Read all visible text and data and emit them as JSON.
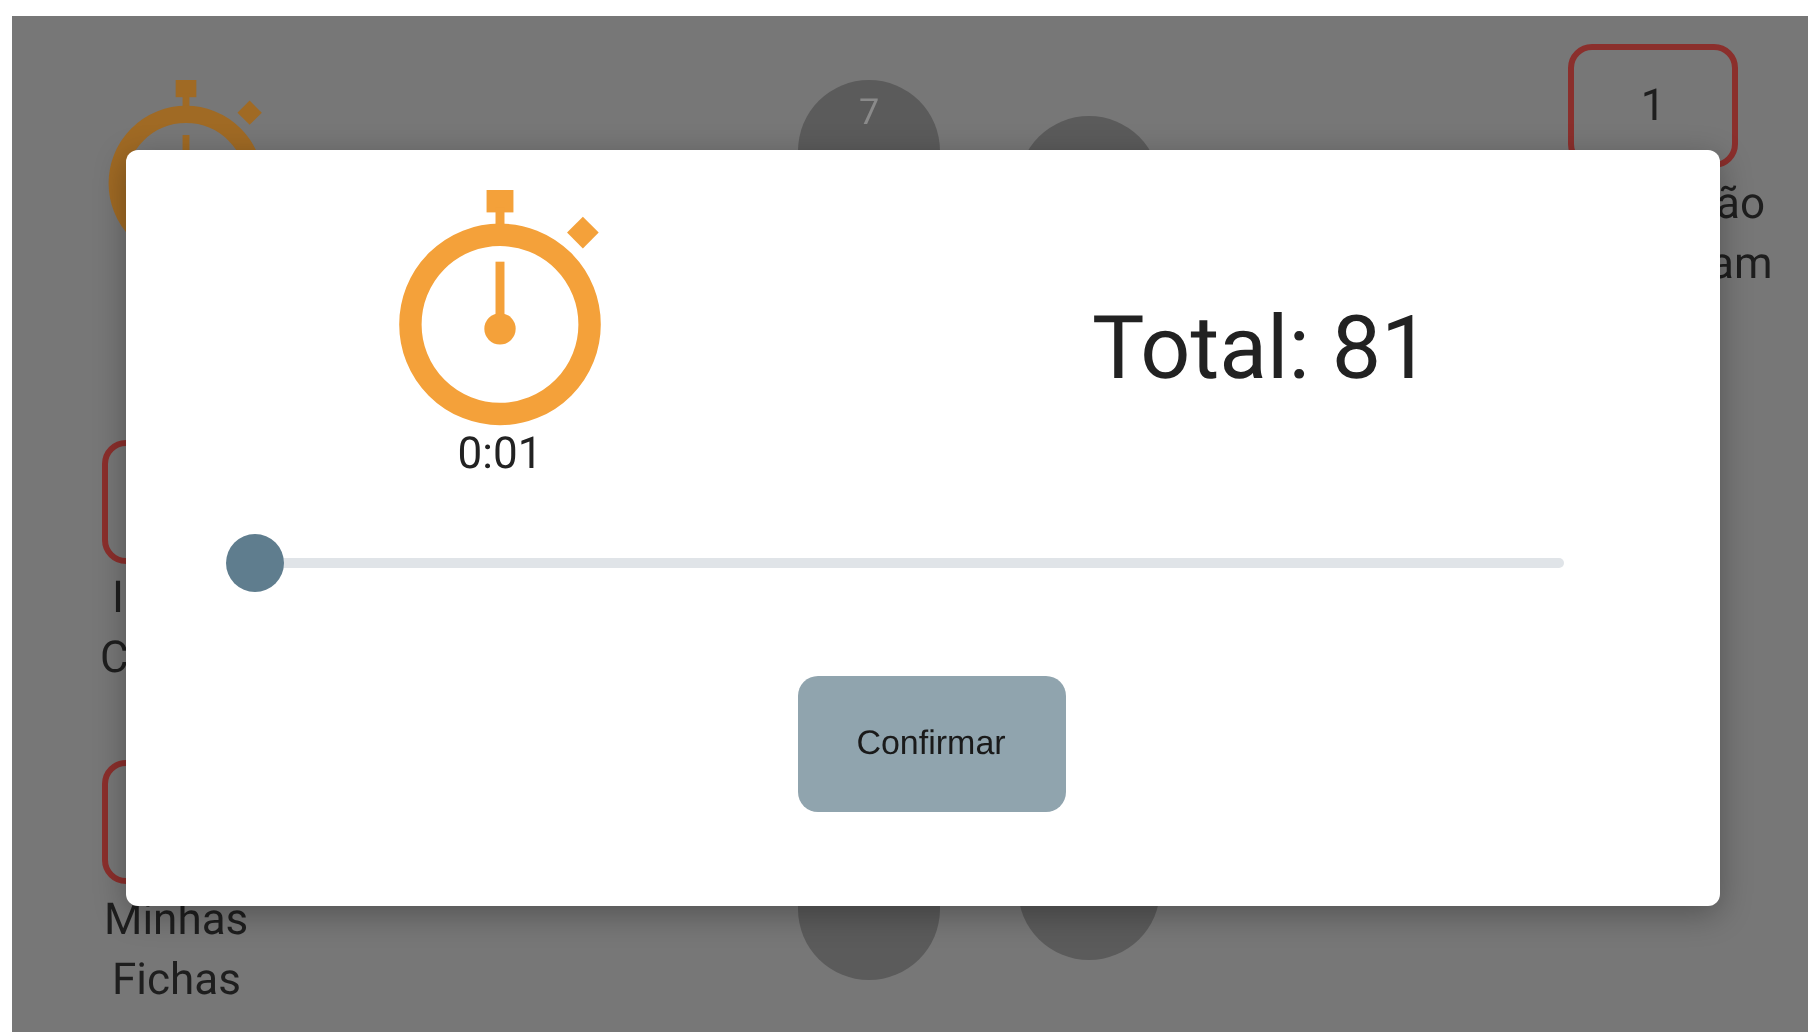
{
  "background": {
    "circle_number": "7",
    "badge": "1",
    "badge_label": [
      "ão",
      "am"
    ],
    "side_label": [
      "I",
      "C"
    ],
    "menu_label": [
      "Minhas",
      "Fichas"
    ]
  },
  "dialog": {
    "timer": "0:01",
    "total": "Total: 81",
    "slider": {
      "level": 0
    },
    "button": "Confirmar"
  }
}
